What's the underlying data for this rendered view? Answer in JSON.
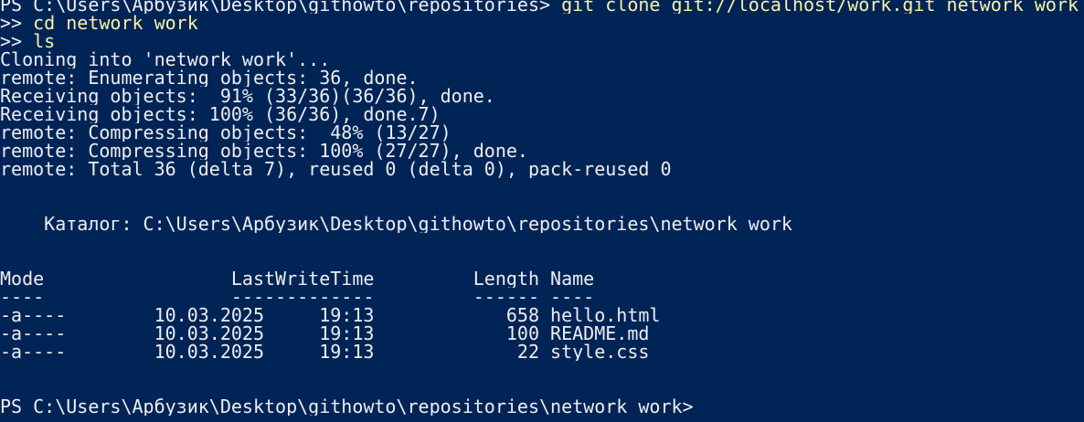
{
  "colors": {
    "background": "#012456",
    "text": "#eeedf0",
    "command": "#f9f1a5"
  },
  "session": {
    "prompt": "PS C:\\Users\\Арбузик\\Desktop\\githowto\\repositories> ",
    "command_1": "git clone git://localhost/work.git network_work",
    "continuation_prompt_1": ">> ",
    "command_2": "cd network_work",
    "continuation_prompt_2": ">> ",
    "command_3": "ls"
  },
  "output": {
    "clone": [
      "Cloning into 'network_work'...",
      "remote: Enumerating objects: 36, done.",
      "Receiving objects:  91% (33/36)(36/36), done.",
      "Receiving objects: 100% (36/36), done.7)",
      "remote: Compressing objects:  48% (13/27)",
      "remote: Compressing objects: 100% (27/27), done.",
      "remote: Total 36 (delta 7), reused 0 (delta 0), pack-reused 0"
    ],
    "directory_line": "    Каталог: C:\\Users\\Арбузик\\Desktop\\githowto\\repositories\\network_work",
    "listing": {
      "header": "Mode                 LastWriteTime         Length Name",
      "underline": "----                 -------------         ------ ----",
      "rows": [
        "-a----        10.03.2025     19:13            658 hello.html",
        "-a----        10.03.2025     19:13            100 README.md",
        "-a----        10.03.2025     19:13             22 style.css"
      ]
    },
    "final_prompt": "PS C:\\Users\\Арбузик\\Desktop\\githowto\\repositories\\network_work>"
  }
}
